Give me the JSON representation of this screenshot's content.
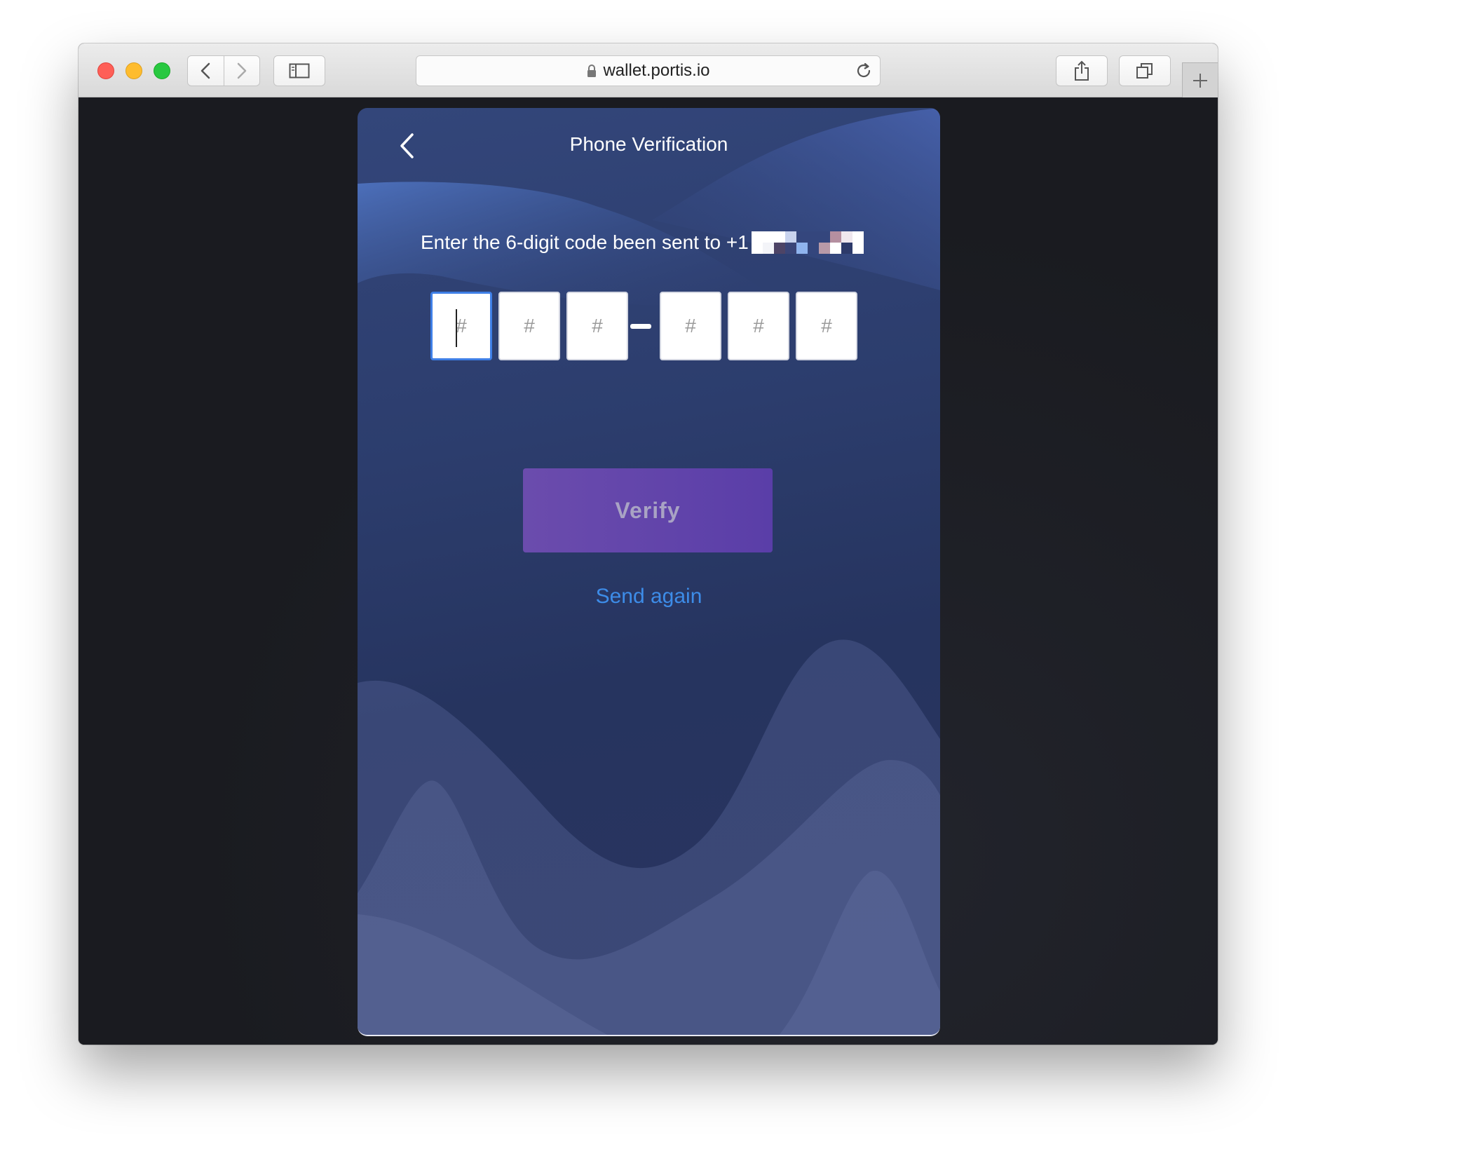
{
  "browser": {
    "url": "wallet.portis.io",
    "new_tab_symbol": "+",
    "icons": {
      "close": "close-traffic-light",
      "minimize": "minimize-traffic-light",
      "maximize": "maximize-traffic-light",
      "back": "chevron-left-icon",
      "forward": "chevron-right-icon",
      "sidebar": "sidebar-icon",
      "lock": "lock-icon",
      "reload": "reload-icon",
      "share": "share-icon",
      "tabs": "tabs-overview-icon"
    }
  },
  "verification": {
    "title": "Phone Verification",
    "instruction": "Enter the 6-digit code been sent to +1",
    "digits": [
      {
        "placeholder": "#",
        "value": ""
      },
      {
        "placeholder": "#",
        "value": ""
      },
      {
        "placeholder": "#",
        "value": ""
      },
      {
        "placeholder": "#",
        "value": ""
      },
      {
        "placeholder": "#",
        "value": ""
      },
      {
        "placeholder": "#",
        "value": ""
      }
    ],
    "verify_label": "Verify",
    "send_again_label": "Send again",
    "back_icon": "chevron-left-icon"
  },
  "colors": {
    "accent_link": "#3d8ce8",
    "button": "#5f43aa",
    "card_bg": "#2c3d6d",
    "active_border": "#3f7fe6"
  }
}
